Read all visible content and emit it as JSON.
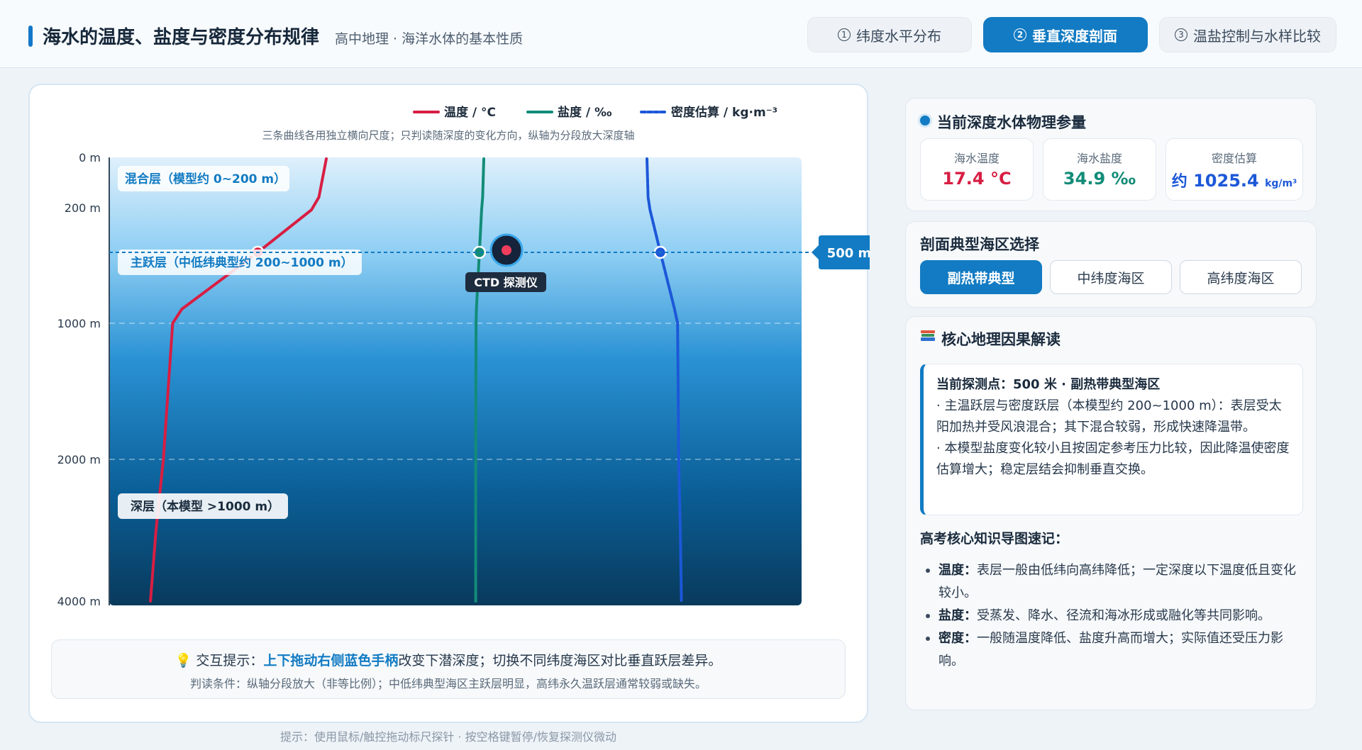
{
  "header": {
    "title": "海水的温度、盐度与密度分布规律",
    "subtitle": "高中地理 · 海洋水体的基本性质",
    "tabs": [
      {
        "num": "1",
        "label": "纬度水平分布",
        "active": false
      },
      {
        "num": "2",
        "label": "垂直深度剖面",
        "active": true
      },
      {
        "num": "3",
        "label": "温盐控制与水样比较",
        "active": false
      }
    ]
  },
  "chart": {
    "legend": [
      {
        "label": "温度 / °C",
        "color": "#d81e43"
      },
      {
        "label": "盐度 / ‰",
        "color": "#128c78"
      },
      {
        "label": "密度估算 / kg·m⁻³",
        "color": "#1c58d8"
      }
    ],
    "note": "三条曲线各用独立横向尺度；只判读随深度的变化方向，纵轴为分段放大深度轴",
    "depth_ticks": [
      "0 m",
      "200 m",
      "1000 m",
      "2000 m",
      "4000 m"
    ],
    "layers": {
      "mixed": "混合层（模型约 0~200 m）",
      "thermocline": "主跃层（中低纬典型约 200~1000 m）",
      "deep": "深层（本模型 >1000 m）"
    },
    "probe_label": "CTD 探测仪",
    "handle_label": "500 m",
    "colors": {
      "temperature": "#d81e43",
      "salinity": "#128c78",
      "density": "#1c58d8",
      "accent": "#127bc3"
    }
  },
  "chart_data": {
    "type": "line",
    "y_axis": "depth (m, piecewise-scaled)",
    "y_ticks": [
      0,
      200,
      1000,
      2000,
      4000
    ],
    "probe_depth": 500,
    "series": [
      {
        "name": "温度 / °C",
        "depth": [
          0,
          150,
          200,
          500,
          900,
          1000,
          2000,
          3000,
          4000
        ],
        "trend": [
          0.0,
          0.04,
          0.08,
          0.37,
          0.78,
          0.83,
          0.88,
          0.92,
          0.95
        ]
      },
      {
        "name": "盐度 / ‰",
        "depth": [
          0,
          150,
          200,
          500,
          900,
          1000,
          2000,
          3000,
          4000
        ],
        "trend": [
          0.0,
          0.03,
          0.06,
          0.12,
          0.2,
          0.21,
          0.22,
          0.22,
          0.22
        ]
      },
      {
        "name": "密度估算 / kg·m⁻³",
        "depth": [
          0,
          150,
          200,
          500,
          900,
          1000,
          2000,
          3000,
          4000
        ],
        "trend": [
          0.0,
          0.03,
          0.08,
          0.35,
          0.72,
          0.8,
          0.83,
          0.87,
          0.9
        ]
      }
    ]
  },
  "hints": {
    "prefix": "交互提示：",
    "highlight": "上下拖动右侧蓝色手柄",
    "suffix": "改变下潜深度；切换不同纬度海区对比垂直跃层差异。",
    "line2": "判读条件：纵轴分段放大（非等比例）；中低纬典型海区主跃层明显，高纬永久温跃层通常较弱或缺失。",
    "footer": "提示：使用鼠标/触控拖动标尺探针 · 按空格键暂停/恢复探测仪微动"
  },
  "params": {
    "title": "当前深度水体物理参量",
    "temp_label": "海水温度",
    "temp_value": "17.4 °C",
    "sal_label": "海水盐度",
    "sal_value": "34.9 ‰",
    "den_label": "密度估算",
    "den_prefix": "约",
    "den_value": "1025.4",
    "den_unit": "kg/m³"
  },
  "regions": {
    "title": "剖面典型海区选择",
    "options": [
      "副热带典型",
      "中纬度海区",
      "高纬度海区"
    ],
    "active_index": 0
  },
  "explain": {
    "title": "核心地理因果解读",
    "line1": "当前探测点：500 米 · 副热带典型海区",
    "line2": "· 主温跃层与密度跃层（本模型约 200~1000 m）：表层受太阳加热并受风浪混合；其下混合较弱，形成快速降温带。",
    "line3": "· 本模型盐度变化较小且按固定参考压力比较，因此降温使密度估算增大；稳定层结会抑制垂直交换。",
    "knowledge_title": "高考核心知识导图速记：",
    "knowledge": [
      {
        "key": "温度：",
        "text": "表层一般由低纬向高纬降低；一定深度以下温度低且变化较小。"
      },
      {
        "key": "盐度：",
        "text": "受蒸发、降水、径流和海冰形成或融化等共同影响。"
      },
      {
        "key": "密度：",
        "text": "一般随温度降低、盐度升高而增大；实际值还受压力影响。"
      }
    ]
  }
}
